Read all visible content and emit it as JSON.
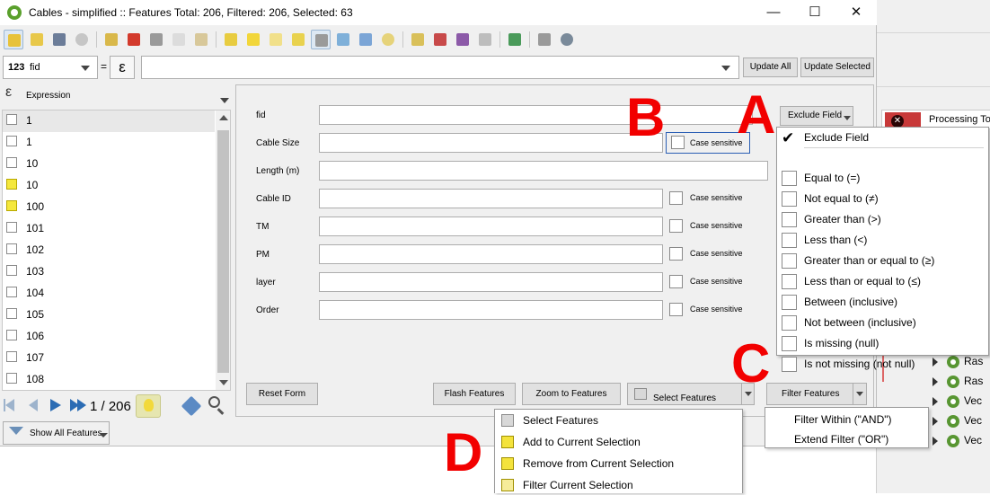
{
  "window": {
    "title": "Cables - simplified :: Features Total: 206, Filtered: 206, Selected: 63",
    "minimize": "—",
    "maximize": "☐",
    "close": "✕"
  },
  "field_bar": {
    "field_selector": "fid",
    "field_type_badge": "123",
    "equals": "=",
    "expression_symbol": "ε",
    "update_all": "Update All",
    "update_selected": "Update Selected"
  },
  "left_panel": {
    "expression_label": "Expression",
    "items": [
      "1",
      "1",
      "10",
      "10",
      "100",
      "101",
      "102",
      "103",
      "104",
      "105",
      "106",
      "107",
      "108"
    ],
    "highlighted": [
      false,
      false,
      false,
      true,
      true,
      false,
      false,
      false,
      false,
      false,
      false,
      false,
      false
    ],
    "nav_counter": "1 / 206",
    "show_all_features": "Show All Features"
  },
  "form": {
    "fields": [
      {
        "label": "fid",
        "case_sensitive": ""
      },
      {
        "label": "Cable Size",
        "case_sensitive": "Case sensitive"
      },
      {
        "label": "Length (m)",
        "case_sensitive": ""
      },
      {
        "label": "Cable ID",
        "case_sensitive": "Case sensitive"
      },
      {
        "label": "TM",
        "case_sensitive": "Case sensitive"
      },
      {
        "label": "PM",
        "case_sensitive": "Case sensitive"
      },
      {
        "label": "layer",
        "case_sensitive": "Case sensitive"
      },
      {
        "label": "Order",
        "case_sensitive": "Case sensitive"
      }
    ],
    "exclude_field_button": "Exclude Field",
    "reset_form": "Reset Form",
    "flash_features": "Flash Features",
    "zoom_to_features": "Zoom to Features",
    "select_features": "Select Features",
    "filter_features": "Filter Features"
  },
  "operator_menu": {
    "items": [
      {
        "label": "Exclude Field",
        "checked": true
      },
      {
        "label": "Equal to (=)",
        "checked": false
      },
      {
        "label": "Not equal to (≠)",
        "checked": false
      },
      {
        "label": "Greater than (>)",
        "checked": false
      },
      {
        "label": "Less than (<)",
        "checked": false
      },
      {
        "label": "Greater than or equal to (≥)",
        "checked": false
      },
      {
        "label": "Less than or equal to (≤)",
        "checked": false
      },
      {
        "label": "Between (inclusive)",
        "checked": false
      },
      {
        "label": "Not between (inclusive)",
        "checked": false
      },
      {
        "label": "Is missing (null)",
        "checked": false
      },
      {
        "label": "Is not missing (not null)",
        "checked": false
      }
    ]
  },
  "filter_menu": {
    "items": [
      "Filter Within (\"AND\")",
      "Extend Filter (\"OR\")"
    ]
  },
  "select_menu": {
    "items": [
      "Select Features",
      "Add to Current Selection",
      "Remove from Current Selection",
      "Filter Current Selection"
    ]
  },
  "annotations": {
    "a": "A",
    "b": "B",
    "c": "C",
    "d": "D"
  },
  "background_window": {
    "processing_label": "Processing To",
    "tree_items": [
      "Ras",
      "Ras",
      "Vec",
      "Vec",
      "Vec"
    ]
  },
  "colors": {
    "annotation_red": "#f20000",
    "selected_yellow": "#f5e83c",
    "focus_blue": "#2b5fb4"
  }
}
